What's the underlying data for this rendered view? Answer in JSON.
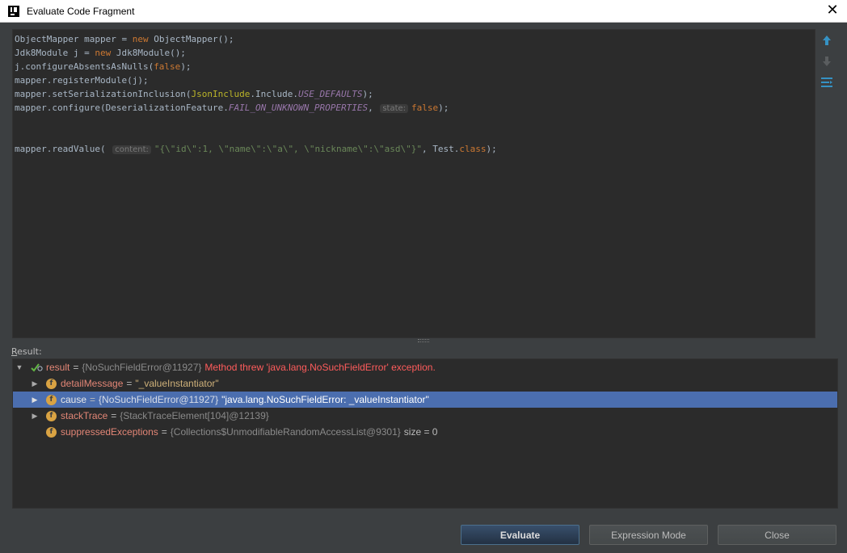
{
  "window": {
    "title": "Evaluate Code Fragment",
    "close_glyph": "✕"
  },
  "editor": {
    "lines": [
      [
        {
          "t": "ObjectMapper mapper = ",
          "c": ""
        },
        {
          "t": "new",
          "c": "kw"
        },
        {
          "t": " ObjectMapper();",
          "c": ""
        }
      ],
      [
        {
          "t": "Jdk8Module j = ",
          "c": ""
        },
        {
          "t": "new",
          "c": "kw"
        },
        {
          "t": " Jdk8Module();",
          "c": ""
        }
      ],
      [
        {
          "t": "j.configureAbsentsAsNulls(",
          "c": ""
        },
        {
          "t": "false",
          "c": "kw"
        },
        {
          "t": ");",
          "c": ""
        }
      ],
      [
        {
          "t": "mapper.registerModule(j);",
          "c": ""
        }
      ],
      [
        {
          "t": "mapper.setSerializationInclusion(",
          "c": ""
        },
        {
          "t": "JsonInclude",
          "c": "ann"
        },
        {
          "t": ".Include.",
          "c": ""
        },
        {
          "t": "USE_DEFAULTS",
          "c": "fld"
        },
        {
          "t": ");",
          "c": ""
        }
      ],
      [
        {
          "t": "mapper.configure(DeserializationFeature.",
          "c": ""
        },
        {
          "t": "FAIL_ON_UNKNOWN_PROPERTIES",
          "c": "fld"
        },
        {
          "t": ", ",
          "c": ""
        },
        {
          "t": "state:",
          "c": "hint"
        },
        {
          "t": "false",
          "c": "kw"
        },
        {
          "t": ");",
          "c": ""
        }
      ],
      [],
      [],
      [
        {
          "t": "mapper.readValue( ",
          "c": ""
        },
        {
          "t": "content:",
          "c": "hint"
        },
        {
          "t": "\"{\\\"id\\\":1, \\\"name\\\":\\\"a\\\", \\\"nickname\\\":\\\"asd\\\"}\"",
          "c": "str"
        },
        {
          "t": ", Test.",
          "c": ""
        },
        {
          "t": "class",
          "c": "kw"
        },
        {
          "t": ");",
          "c": ""
        }
      ]
    ]
  },
  "side_tools": [
    "arrow-up-icon",
    "arrow-down-icon",
    "settings-wrap-icon"
  ],
  "result": {
    "label_underlined": "R",
    "label_rest": "esult:",
    "root": {
      "name": "result",
      "eq": "=",
      "ref": "{NoSuchFieldError@11927}",
      "message": "Method threw 'java.lang.NoSuchFieldError' exception."
    },
    "children": [
      {
        "name": "detailMessage",
        "eq": "=",
        "ref": "",
        "value": "\"_valueInstantiator\"",
        "extra": "",
        "expandable": true,
        "selected": false
      },
      {
        "name": "cause",
        "eq": "=",
        "ref": "{NoSuchFieldError@11927}",
        "value": "\"java.lang.NoSuchFieldError: _valueInstantiator\"",
        "extra": "",
        "expandable": true,
        "selected": true
      },
      {
        "name": "stackTrace",
        "eq": "=",
        "ref": "{StackTraceElement[104]@12139}",
        "value": "",
        "extra": "",
        "expandable": true,
        "selected": false
      },
      {
        "name": "suppressedExceptions",
        "eq": "=",
        "ref": "{Collections$UnmodifiableRandomAccessList@9301}",
        "value": "",
        "extra": "size = 0",
        "expandable": false,
        "selected": false
      }
    ]
  },
  "buttons": {
    "evaluate": "Evaluate",
    "expression_mode": "Expression Mode",
    "close": "Close"
  },
  "colors": {
    "background": "#3c3f41",
    "editor_bg": "#2b2b2b",
    "selection": "#4b6eaf",
    "keyword": "#cc7832",
    "error": "#ff5c5c"
  }
}
